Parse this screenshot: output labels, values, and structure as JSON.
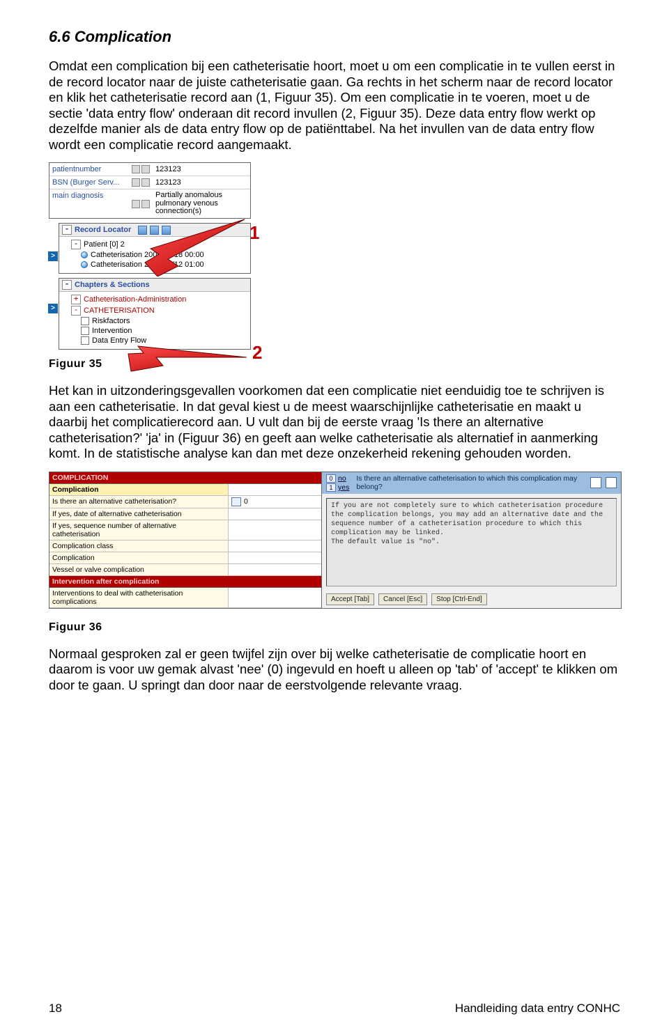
{
  "heading": "6.6 Complication",
  "p1": "Omdat een complication bij een catheterisatie hoort, moet u om een complicatie in te vullen eerst in de record locator naar de juiste catheterisatie gaan. Ga rechts in het scherm naar de record locator en klik het catheterisatie record aan (1, Figuur 35). Om een complicatie in te voeren, moet u de sectie 'data entry flow' onderaan dit record invullen (2, Figuur 35). Deze data entry flow werkt op dezelfde manier als de data entry flow op de patiënttabel. Na het invullen van de data entry flow wordt een complicatie record aangemaakt.",
  "fig35": "Figuur 35",
  "p2": "Het kan in uitzonderingsgevallen voorkomen dat een complicatie niet eenduidig toe te schrijven is aan een catheterisatie. In dat geval kiest u de meest waarschijnlijke catheterisatie en maakt u daarbij het complicatierecord aan. U vult dan bij de eerste vraag 'Is there an alternative catheterisation?' 'ja' in (Figuur 36) en geeft aan welke catheterisatie als alternatief in aanmerking komt. In de statistische analyse kan dan met deze onzekerheid rekening gehouden worden.",
  "fig36": "Figuur 36",
  "p3": "Normaal gesproken zal er geen twijfel zijn over bij welke catheterisatie de complicatie hoort en daarom is voor uw gemak alvast 'nee' (0) ingevuld en hoeft u alleen op 'tab' of 'accept' te klikken om door te gaan. U springt dan door naar de eerstvolgende relevante vraag.",
  "footer_page": "18",
  "footer_label": "Handleiding data entry CONHC",
  "shot1": {
    "kv": [
      {
        "k": "patientnumber",
        "v": "123123"
      },
      {
        "k": "BSN (Burger Serv...",
        "v": "123123"
      },
      {
        "k": "main diagnosis",
        "v": "Partially anomalous pulmonary venous connection(s)"
      }
    ],
    "rl_title": "Record Locator",
    "rl_patient": "Patient [0] 2",
    "rl_items": [
      "Catheterisation  2009/06/18 00:00",
      "Catheterisation  2009/12/12 01:00"
    ],
    "cs_title": "Chapters & Sections",
    "cs_row1": "Catheterisation-Administration",
    "cs_row2": "CATHETERISATION",
    "cs_sub": [
      "Riskfactors",
      "Intervention",
      "Data Entry Flow"
    ],
    "call1": "1",
    "call2": "2"
  },
  "shot2": {
    "group1": "COMPLICATION",
    "sub1": "Complication",
    "rows1": [
      "Is there an alternative catheterisation?",
      "If yes, date of alternative catheterisation",
      "If yes, sequence number of alternative catheterisation",
      "Complication class",
      "Complication",
      "Vessel or valve complication"
    ],
    "group2": "Intervention after complication",
    "rows2": [
      "Interventions to deal with catheterisation complications"
    ],
    "val_first": "0",
    "question": "Is there an alternative catheterisation to which this complication may belong?",
    "opts": [
      {
        "n": "0",
        "l": "no"
      },
      {
        "n": "1",
        "l": "yes"
      }
    ],
    "help": "If you are not completely sure to which catheterisation procedure the complication belongs, you may add an alternative date and the sequence number of a catheterisation procedure to which this complication may be linked.\nThe default value is \"no\".",
    "btnAccept": "Accept [Tab]",
    "btnCancel": "Cancel [Esc]",
    "btnStop": "Stop [Ctrl-End]"
  }
}
